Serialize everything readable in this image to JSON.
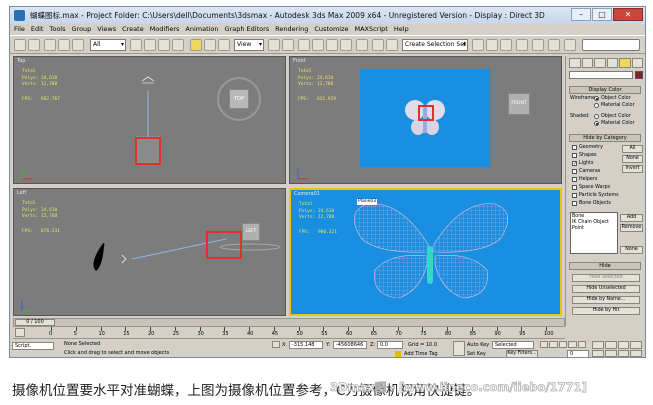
{
  "window": {
    "title": "蝴蝶图标.max    - Project Folder: C:\\Users\\dell\\Documents\\3dsmax    - Autodesk 3ds Max  2009 x64    - Unregistered Version    - Display : Direct 3D",
    "minimize": "–",
    "maximize": "□",
    "close": "✕"
  },
  "menu": [
    "File",
    "Edit",
    "Tools",
    "Group",
    "Views",
    "Create",
    "Modifiers",
    "Animation",
    "Graph Editors",
    "Rendering",
    "Customize",
    "MAXScript",
    "Help"
  ],
  "toolbar": {
    "selection_filter": "All",
    "ref_coord": "View",
    "named_selection": "Create Selection Set"
  },
  "viewports": [
    {
      "label": "Top",
      "stats": [
        "Total",
        "Polys: 24,610",
        "Verts: 12,788"
      ],
      "fps": "FPS:   602.767",
      "cube": "TOP"
    },
    {
      "label": "Front",
      "stats": [
        "Total",
        "Polys: 24,610",
        "Verts: 12,788"
      ],
      "fps": "FPS:   612.929",
      "cube": "FRONT"
    },
    {
      "label": "Left",
      "stats": [
        "Total",
        "Polys: 24,610",
        "Verts: 12,788"
      ],
      "fps": "FPS:   676.231",
      "cube": "LEFT"
    },
    {
      "label": "Camera01",
      "stats": [
        "Total",
        "Polys: 24,610",
        "Verts: 12,788"
      ],
      "fps": "FPS:   900.321",
      "object_label": "Plane03"
    }
  ],
  "command_panel": {
    "display_color": {
      "header": "Display Color",
      "wireframe_label": "Wireframe:",
      "shaded_label": "Shaded:",
      "object_color": "Object Color",
      "material_color": "Material Color"
    },
    "hide_by_category": {
      "header": "Hide by Category",
      "items": [
        "Geometry",
        "Shapes",
        "Lights",
        "Cameras",
        "Helpers",
        "Space Warps",
        "Particle Systems",
        "Bone Objects"
      ],
      "checked": [
        "Lights"
      ],
      "all": "All",
      "none": "None",
      "invert": "Invert",
      "list_items": [
        "Bone",
        "IK Chain Object",
        "Point"
      ],
      "add": "Add",
      "remove": "Remove",
      "none2": "None"
    },
    "hide": {
      "header": "Hide",
      "buttons": [
        "Hide Selected",
        "Hide Unselected",
        "Hide by Name...",
        "Hide by Hit"
      ]
    }
  },
  "timeline": {
    "frame_counter": "0 / 100",
    "ticks": [
      "0",
      "5",
      "10",
      "15",
      "20",
      "25",
      "30",
      "35",
      "40",
      "45",
      "50",
      "55",
      "60",
      "65",
      "70",
      "75",
      "80",
      "85",
      "90",
      "95",
      "100"
    ]
  },
  "status": {
    "maxscript": "Script.",
    "selection": "None Selected",
    "prompt": "Click and drag to select and move objects",
    "x_label": "X:",
    "x_value": "-315.148",
    "y_label": "Y:",
    "y_value": "-45608646",
    "z_label": "Z:",
    "z_value": "0.0",
    "grid": "Grid = 10.0",
    "add_time_tag": "Add Time Tag",
    "auto_key": "Auto Key",
    "set_key": "Set Key",
    "key_mode": "Selected",
    "key_filters": "Key Filters...",
    "frame": "0"
  },
  "caption": "摄像机位置要水平对准蝴蝶，上图为摄像机位置参考，C为摄像机视角快捷键。",
  "watermark": "3Dmax吧 - [www.iineco.com/iiebo/1771]",
  "colors": {
    "viewport_bg": "#7c7c7c",
    "render_bg": "#1a8ee0",
    "highlight": "#e03030",
    "active_border": "#e6c800"
  }
}
